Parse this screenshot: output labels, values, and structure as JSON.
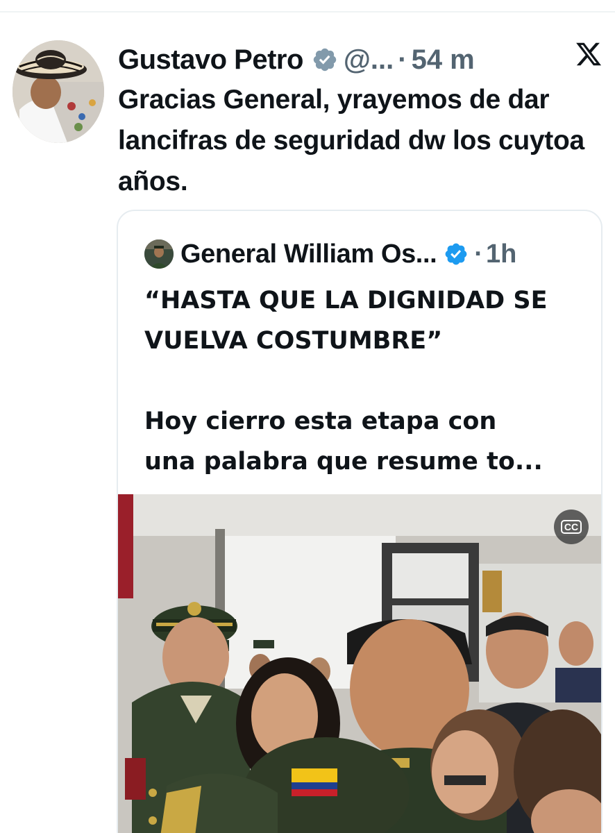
{
  "tweet": {
    "author_name": "Gustavo Petro",
    "handle": "@...",
    "separator": "·",
    "time": "54 m",
    "text": "Gracias General, yrayemos de dar lancifras de seguridad dw los cuytoa años.",
    "avatar_icon": "profile-photo",
    "verified_icon": "verified-badge",
    "verified_color": "#829aab",
    "platform_icon": "x-logo-icon"
  },
  "quote": {
    "author_name": "General William Os...",
    "separator": "·",
    "time": "1h",
    "verified_icon": "verified-badge",
    "verified_color": "#1d9bf0",
    "text_lines": [
      "“HASTA QUE LA DIGNIDAD SE",
      "VUELVA COSTUMBRE”",
      "",
      "Hoy cierro esta etapa con",
      "una palabra que resume to..."
    ],
    "media": {
      "type": "video",
      "cc_label": "CC",
      "cc_icon": "closed-captions-icon"
    }
  }
}
